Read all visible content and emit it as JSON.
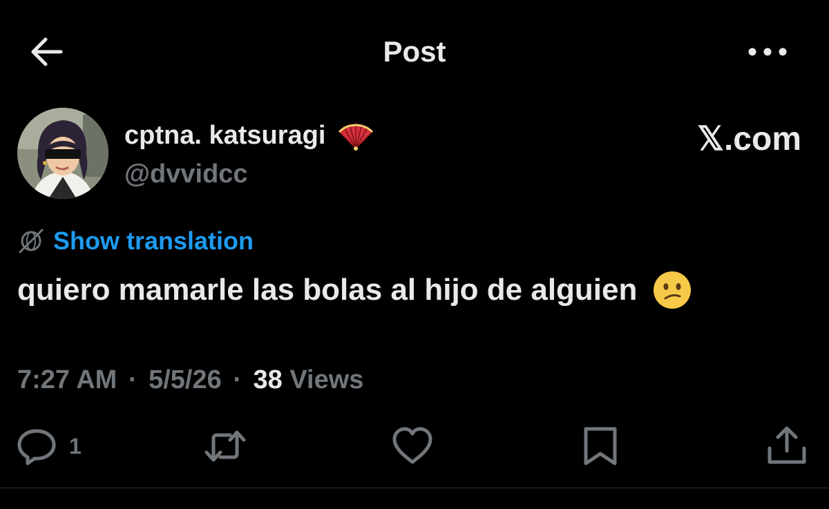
{
  "header": {
    "title": "Post",
    "back_icon": "arrow-left-icon",
    "more_icon": "more-horizontal-icon"
  },
  "author": {
    "display_name": "cptna. katsuragi",
    "name_emoji": "folding-fan-emoji",
    "handle": "@dvvidcc",
    "avatar": "anime-character-avatar"
  },
  "watermark": "𝕏.com",
  "translation": {
    "icon": "globe-slash-icon",
    "label": "Show translation"
  },
  "post": {
    "text": "quiero mamarle las bolas al hijo de alguien",
    "emoji": "confused-face-emoji"
  },
  "meta": {
    "time": "7:27 AM",
    "separator": "·",
    "date": "5/5/26",
    "views_count": "38",
    "views_label": "Views"
  },
  "actions": {
    "reply_count": "1",
    "icons": [
      "reply-icon",
      "retweet-icon",
      "like-icon",
      "bookmark-icon",
      "share-icon"
    ]
  },
  "colors": {
    "background": "#000000",
    "primary_text": "#e7e9ea",
    "secondary_text": "#71767b",
    "link": "#1d9bf0",
    "divider": "#2f3336"
  }
}
